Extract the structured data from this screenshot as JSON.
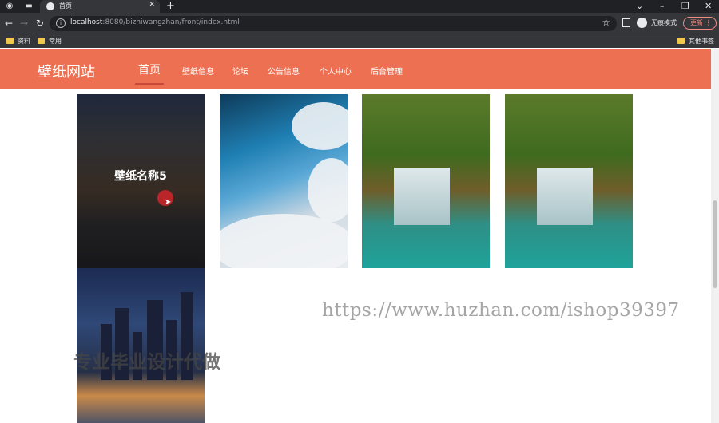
{
  "browser": {
    "tab_title": "首页",
    "url_host": "localhost",
    "url_rest": ":8080/bizhiwangzhan/front/index.html",
    "profile_label": "无痕模式",
    "update_label": "更新",
    "bookmarks": [
      "资料",
      "常用"
    ],
    "other_bookmarks": "其他书签"
  },
  "site": {
    "brand": "壁纸网站",
    "menu": [
      "首页",
      "壁纸信息",
      "论坛",
      "公告信息",
      "个人中心",
      "后台管理"
    ]
  },
  "wallpapers": [
    {
      "caption": "壁纸名称5"
    }
  ],
  "watermark": {
    "url": "https://www.huzhan.com/ishop39397",
    "text": "专业毕业设计代做"
  },
  "colors": {
    "nav_bg": "#ee7052",
    "browser_dark": "#202124"
  }
}
